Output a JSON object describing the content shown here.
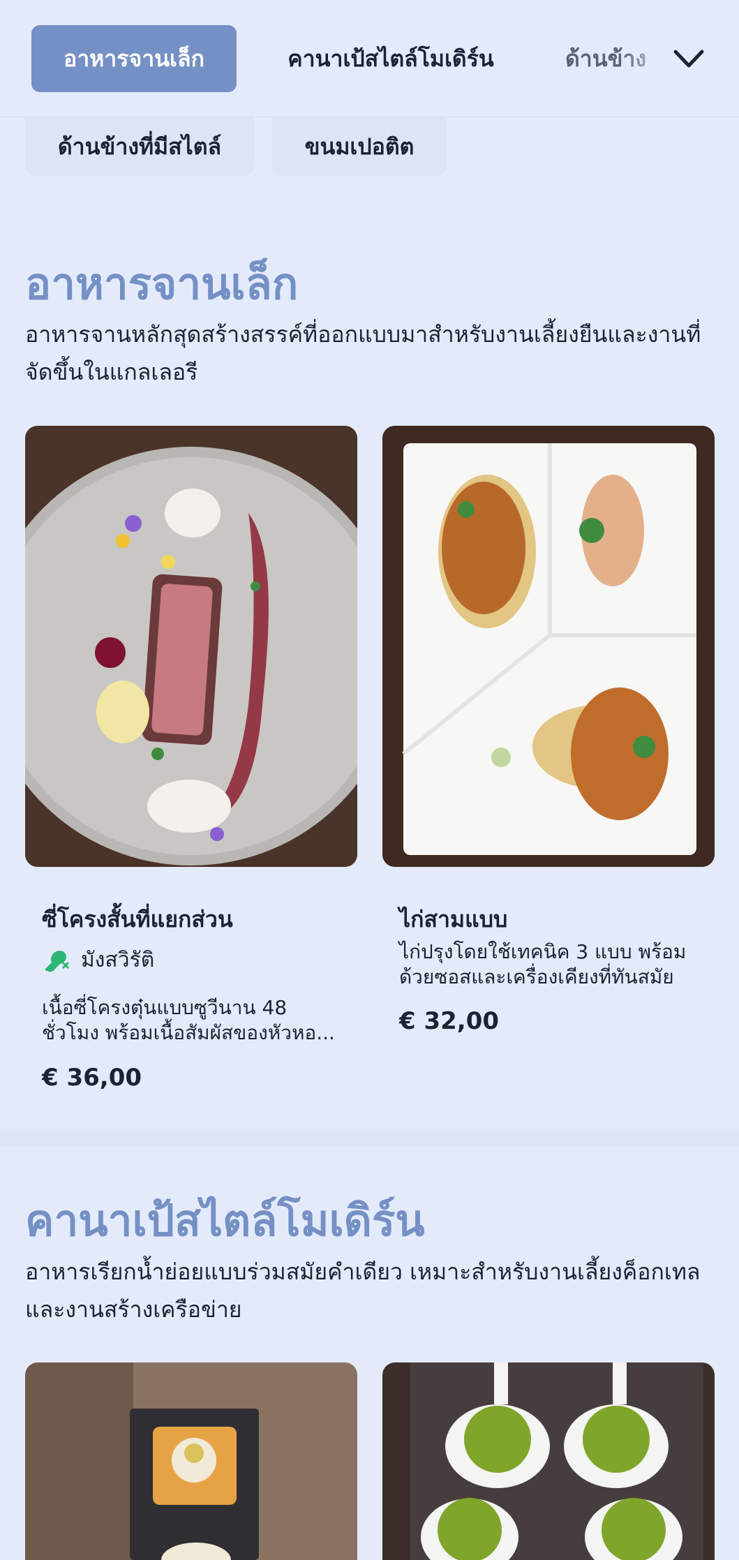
{
  "tabs": [
    "อาหารจานเล็ก",
    "คานาเป้สไตล์โมเดิร์น",
    "ด้านข้าง"
  ],
  "chips": [
    "ด้านข้างที่มีสไตล์",
    "ขนมเปอติต"
  ],
  "sections": [
    {
      "title": "อาหารจานเล็ก",
      "desc": "อาหารจานหลักสุดสร้างสรรค์ที่ออกแบบมาสำหรับงานเลี้ยงยืนและงานที่จัดขึ้นในแกลเลอรี",
      "cards": [
        {
          "title": "ซี่โครงสั้นที่แยกส่วน",
          "tag": "มังสวิรัติ",
          "desc": "เนื้อซี่โครงตุ๋นแบบซูวีนาน 48 ชั่วโมง พร้อมเนื้อสัมผัสของหัวหอ...",
          "price": "€ 36,00"
        },
        {
          "title": "ไก่สามแบบ",
          "desc": "ไก่ปรุงโดยใช้เทคนิค 3 แบบ พร้อมด้วยซอสและเครื่องเคียงที่ทันสมัย",
          "price": "€ 32,00"
        }
      ]
    },
    {
      "title": "คานาเป้สไตล์โมเดิร์น",
      "desc": "อาหารเรียกน้ำย่อยแบบร่วมสมัยคำเดียว เหมาะสำหรับงานเลี้ยงค็อกเทลและงานสร้างเครือข่าย"
    }
  ],
  "icons": {
    "dropdown": "chevron-down-icon",
    "vegetarian": "vegetarian-drumstick-icon"
  },
  "colors": {
    "accent": "#7590c4",
    "background": "#e3ebfb",
    "vegetarian": "#2bb673"
  }
}
